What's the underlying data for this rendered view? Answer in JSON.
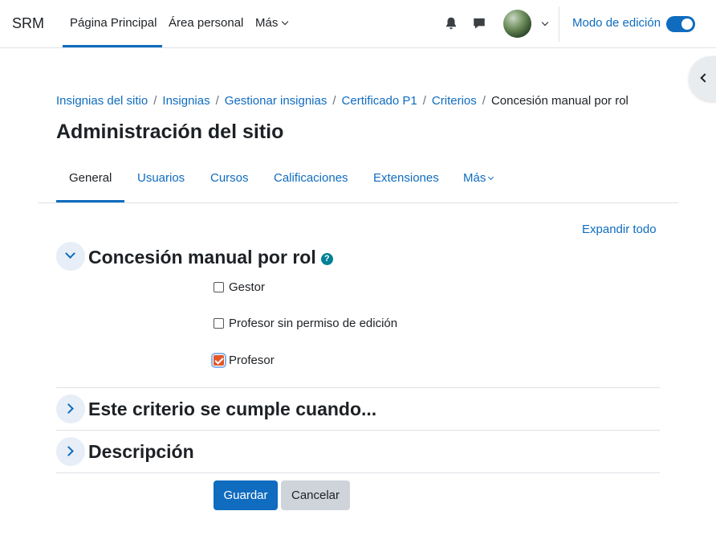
{
  "navbar": {
    "brand": "SRM",
    "items": [
      {
        "label": "Página Principal",
        "active": true
      },
      {
        "label": "Área personal"
      },
      {
        "label": "Más"
      }
    ],
    "icons": [
      "bell-icon",
      "message-icon"
    ],
    "edit_mode_label": "Modo de edición",
    "edit_mode_on": true
  },
  "breadcrumb": [
    "Insignias del sitio",
    "Insignias",
    "Gestionar insignias",
    "Certificado P1",
    "Criterios",
    "Concesión manual por rol"
  ],
  "page_title": "Administración del sitio",
  "tabs": [
    {
      "label": "General",
      "active": true
    },
    {
      "label": "Usuarios"
    },
    {
      "label": "Cursos"
    },
    {
      "label": "Calificaciones"
    },
    {
      "label": "Extensiones"
    },
    {
      "label": "Más"
    }
  ],
  "expand_all": "Expandir todo",
  "sections": [
    {
      "title": "Concesión manual por rol",
      "expanded": true,
      "help_icon": "?",
      "roles": [
        {
          "label": "Gestor",
          "checked": false
        },
        {
          "label": "Profesor sin permiso de edición",
          "checked": false
        },
        {
          "label": "Profesor",
          "checked": true
        }
      ]
    },
    {
      "title": "Este criterio se cumple cuando...",
      "expanded": false
    },
    {
      "title": "Descripción",
      "expanded": false
    }
  ],
  "buttons": {
    "save": "Guardar",
    "cancel": "Cancelar"
  },
  "colors": {
    "primary": "#0f6cbf",
    "checkbox_checked": "#e3572a",
    "help": "#008196"
  }
}
